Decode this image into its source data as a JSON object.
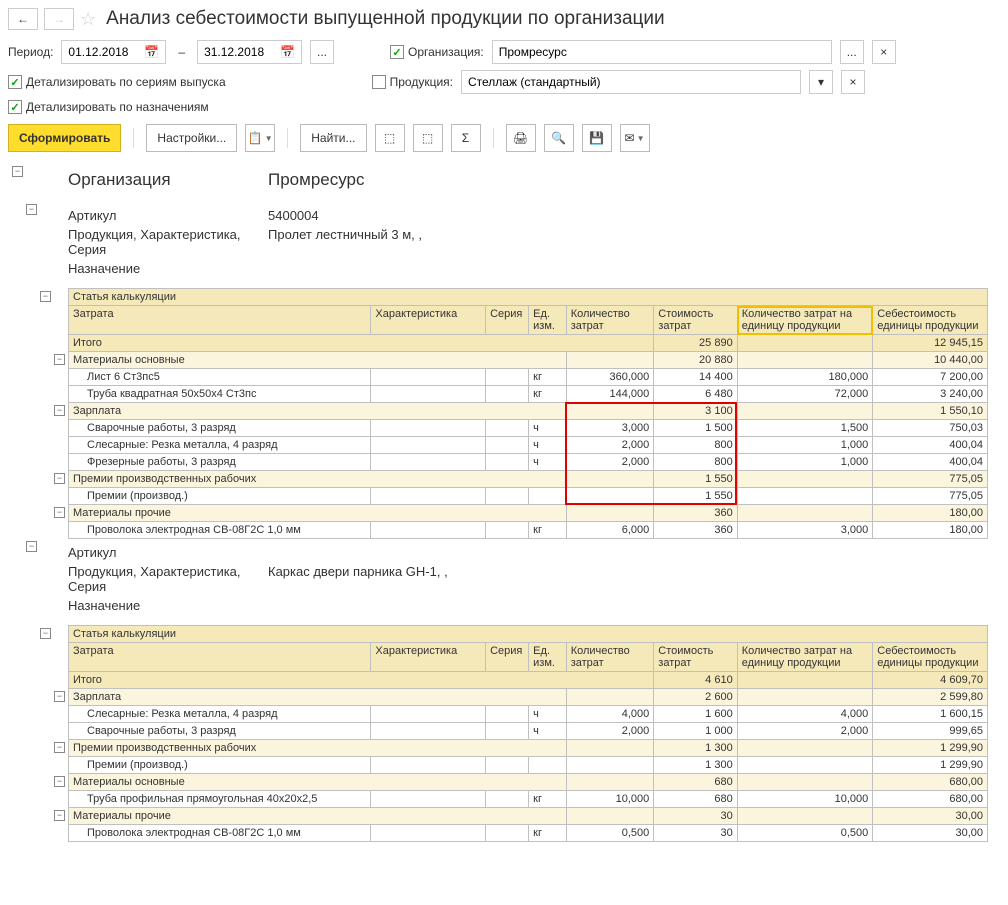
{
  "title": "Анализ себестоимости выпущенной продукции по организации",
  "filters": {
    "period_label": "Период:",
    "date_from": "01.12.2018",
    "date_to": "31.12.2018",
    "org_label": "Организация:",
    "org_value": "Промресурс",
    "prod_label": "Продукция:",
    "prod_value": "Стеллаж (стандартный)",
    "detail_series": "Детализировать по сериям выпуска",
    "detail_purpose": "Детализировать по назначениям"
  },
  "toolbar": {
    "run": "Сформировать",
    "settings": "Настройки...",
    "find": "Найти..."
  },
  "report": {
    "org_label": "Организация",
    "org_value": "Промресурс",
    "sku_label": "Артикул",
    "prod_label": "Продукция, Характеристика, Серия",
    "purpose_label": "Назначение",
    "headers": {
      "calc_item": "Статья калькуляции",
      "cost": "Затрата",
      "char": "Характеристика",
      "series": "Серия",
      "um": "Ед. изм.",
      "qty": "Количество затрат",
      "amount": "Стоимость затрат",
      "qty_unit": "Количество затрат на единицу продукции",
      "cost_unit": "Себестоимость единицы продукции"
    },
    "total_label": "Итого",
    "blocks": [
      {
        "sku": "5400004",
        "product": "Пролет лестничный 3 м, ,",
        "total_amount": "25 890",
        "total_cost_unit": "12 945,15",
        "groups": [
          {
            "name": "Материалы основные",
            "amount": "20 880",
            "cost_unit": "10 440,00",
            "rows": [
              {
                "name": "Лист 6 Ст3пс5",
                "um": "кг",
                "qty": "360,000",
                "amount": "14 400",
                "qty_unit": "180,000",
                "cost_unit": "7 200,00"
              },
              {
                "name": "Труба квадратная 50х50х4 Ст3пс",
                "um": "кг",
                "qty": "144,000",
                "amount": "6 480",
                "qty_unit": "72,000",
                "cost_unit": "3 240,00"
              }
            ]
          },
          {
            "name": "Зарплата",
            "amount": "3 100",
            "cost_unit": "1 550,10",
            "highlight": "red",
            "rows": [
              {
                "name": "Сварочные работы, 3 разряд",
                "um": "ч",
                "qty": "3,000",
                "amount": "1 500",
                "qty_unit": "1,500",
                "cost_unit": "750,03"
              },
              {
                "name": "Слесарные: Резка металла, 4 разряд",
                "um": "ч",
                "qty": "2,000",
                "amount": "800",
                "qty_unit": "1,000",
                "cost_unit": "400,04"
              },
              {
                "name": "Фрезерные работы, 3 разряд",
                "um": "ч",
                "qty": "2,000",
                "amount": "800",
                "qty_unit": "1,000",
                "cost_unit": "400,04"
              }
            ]
          },
          {
            "name": "Премии производственных рабочих",
            "amount": "1 550",
            "cost_unit": "775,05",
            "highlight": "red-partial",
            "rows": [
              {
                "name": "Премии (производ.)",
                "amount": "1 550",
                "cost_unit": "775,05"
              }
            ]
          },
          {
            "name": "Материалы прочие",
            "amount": "360",
            "cost_unit": "180,00",
            "rows": [
              {
                "name": "Проволока электродная СВ-08Г2С 1,0 мм",
                "um": "кг",
                "qty": "6,000",
                "amount": "360",
                "qty_unit": "3,000",
                "cost_unit": "180,00"
              }
            ]
          }
        ]
      },
      {
        "sku": "",
        "product": "Каркас двери парника GH-1, ,",
        "total_amount": "4 610",
        "total_cost_unit": "4 609,70",
        "groups": [
          {
            "name": "Зарплата",
            "amount": "2 600",
            "cost_unit": "2 599,80",
            "rows": [
              {
                "name": "Слесарные: Резка металла, 4 разряд",
                "um": "ч",
                "qty": "4,000",
                "amount": "1 600",
                "qty_unit": "4,000",
                "cost_unit": "1 600,15"
              },
              {
                "name": "Сварочные работы, 3 разряд",
                "um": "ч",
                "qty": "2,000",
                "amount": "1 000",
                "qty_unit": "2,000",
                "cost_unit": "999,65"
              }
            ]
          },
          {
            "name": "Премии производственных рабочих",
            "amount": "1 300",
            "cost_unit": "1 299,90",
            "rows": [
              {
                "name": "Премии (производ.)",
                "amount": "1 300",
                "cost_unit": "1 299,90"
              }
            ]
          },
          {
            "name": "Материалы основные",
            "amount": "680",
            "cost_unit": "680,00",
            "rows": [
              {
                "name": "Труба профильная прямоугольная 40х20х2,5",
                "um": "кг",
                "qty": "10,000",
                "amount": "680",
                "qty_unit": "10,000",
                "cost_unit": "680,00"
              }
            ]
          },
          {
            "name": "Материалы прочие",
            "amount": "30",
            "cost_unit": "30,00",
            "rows": [
              {
                "name": "Проволока электродная СВ-08Г2С 1,0 мм",
                "um": "кг",
                "qty": "0,500",
                "amount": "30",
                "qty_unit": "0,500",
                "cost_unit": "30,00"
              }
            ]
          }
        ]
      }
    ]
  }
}
